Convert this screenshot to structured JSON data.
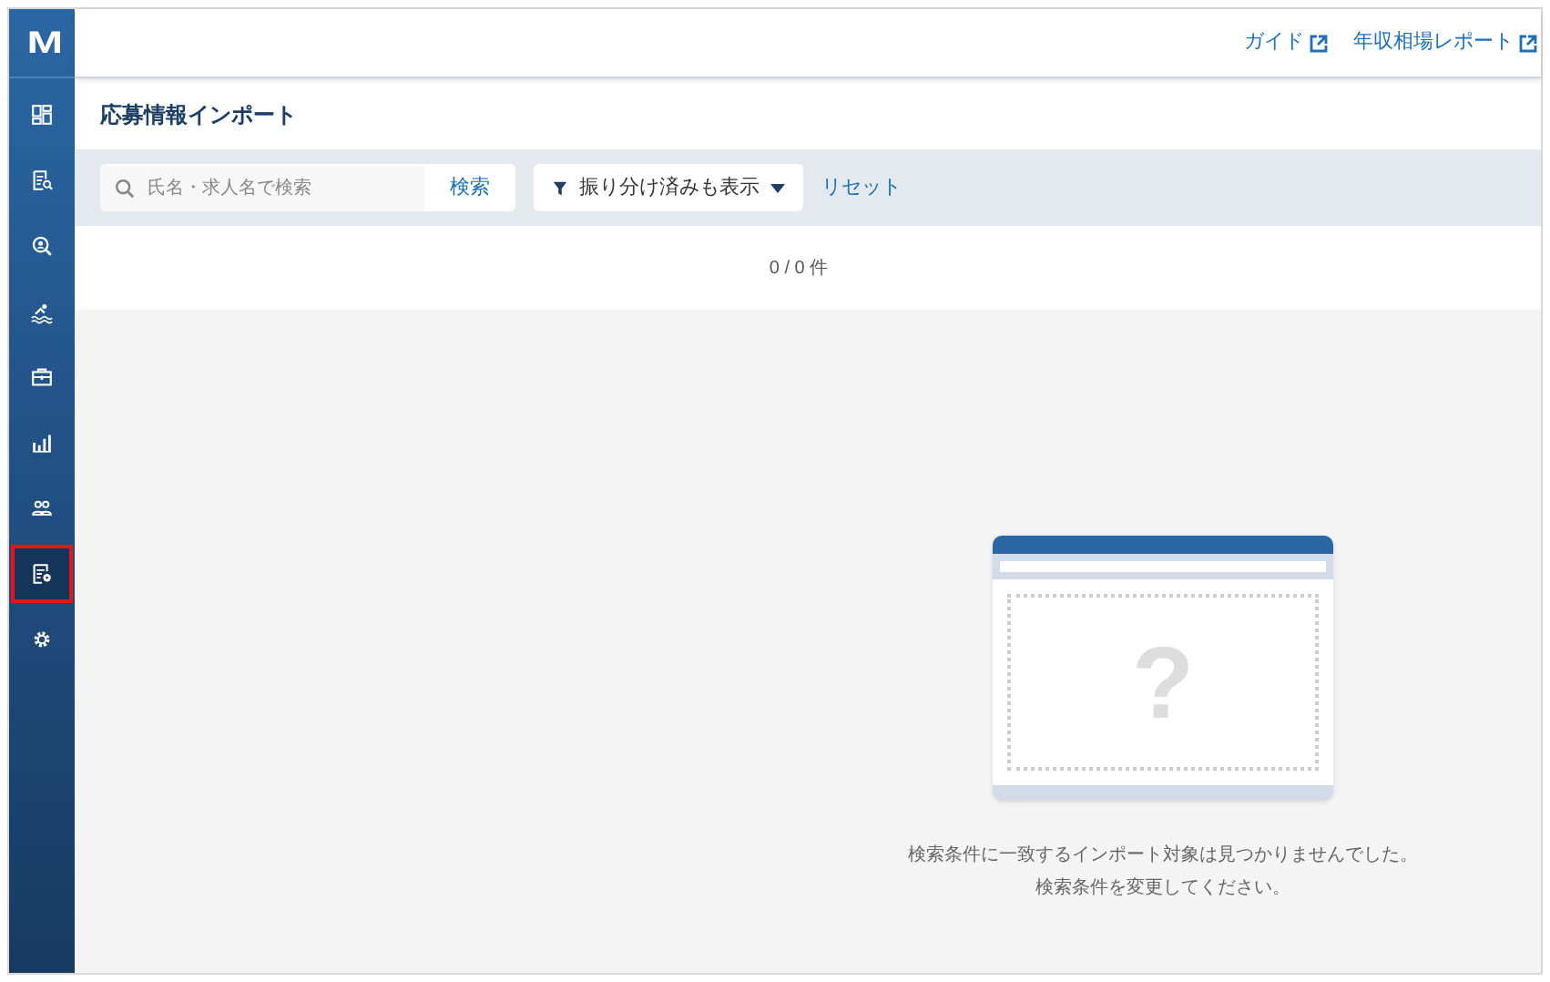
{
  "sidebar": {
    "logo": "M",
    "items": [
      {
        "kind": "dashboard",
        "selected": false
      },
      {
        "kind": "document-search",
        "selected": false
      },
      {
        "kind": "person-search",
        "selected": false
      },
      {
        "kind": "swimmer",
        "selected": false
      },
      {
        "kind": "briefcase",
        "selected": false
      },
      {
        "kind": "bar-chart",
        "selected": false
      },
      {
        "kind": "people",
        "selected": false
      },
      {
        "kind": "document-gear",
        "selected": true
      },
      {
        "kind": "gear",
        "selected": false
      }
    ]
  },
  "header": {
    "links": [
      "ガイド",
      "年収相場レポート"
    ]
  },
  "page_title": "応募情報インポート",
  "filter_bar": {
    "search": {
      "placeholder": "氏名・求人名で検索",
      "button": "検索"
    },
    "filter_dropdown": "振り分け済みも表示",
    "reset": "リセット"
  },
  "count": "0 / 0 件",
  "empty_state": {
    "mark": "?",
    "lines": [
      "検索条件に一致するインポート対象は見つかりませんでした。",
      "検索条件を変更してください。"
    ]
  }
}
